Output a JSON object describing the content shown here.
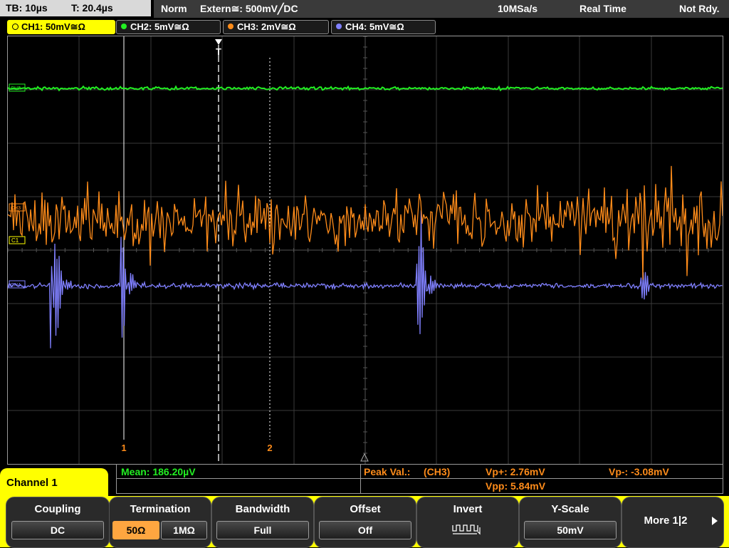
{
  "status": {
    "timebase": "TB: 10µs",
    "trigger_time": "T: 20.4µs",
    "mode": "Norm",
    "trigger_source": "Extern≅: 500mV╱DC",
    "sample_rate": "10MSa/s",
    "acq_mode": "Real Time",
    "ready_state": "Not Rdy."
  },
  "channels": [
    {
      "label": "CH1: 50mV≅Ω",
      "color": "#ffff00",
      "active": true
    },
    {
      "label": "CH2: 5mV≅Ω",
      "color": "#22ee22",
      "active": false
    },
    {
      "label": "CH3: 2mV≅Ω",
      "color": "#ff8c1a",
      "active": false
    },
    {
      "label": "CH4: 5mV≅Ω",
      "color": "#8080ff",
      "active": false
    }
  ],
  "markers": {
    "ch2": "CH2",
    "ch3": "CH3",
    "ch1": "C1",
    "ch4": "CH4",
    "cursor1": "1",
    "cursor2": "2",
    "trigger": "T"
  },
  "measurements": {
    "mean_label": "Mean: 186.20µV",
    "peak_label": "Peak Val.:",
    "peak_source": "(CH3)",
    "vp_plus": "Vp+: 2.76mV",
    "vp_minus": "Vp-: -3.08mV",
    "vpp": "Vpp: 5.84mV"
  },
  "menu": {
    "title": "Channel 1",
    "coupling": {
      "label": "Coupling",
      "value": "DC"
    },
    "termination": {
      "label": "Termination",
      "option1": "50Ω",
      "option2": "1MΩ"
    },
    "bandwidth": {
      "label": "Bandwidth",
      "value": "Full"
    },
    "offset": {
      "label": "Offset",
      "value": "Off"
    },
    "invert": {
      "label": "Invert"
    },
    "yscale": {
      "label": "Y-Scale",
      "value": "50mV"
    },
    "more": {
      "label": "More 1|2"
    }
  }
}
